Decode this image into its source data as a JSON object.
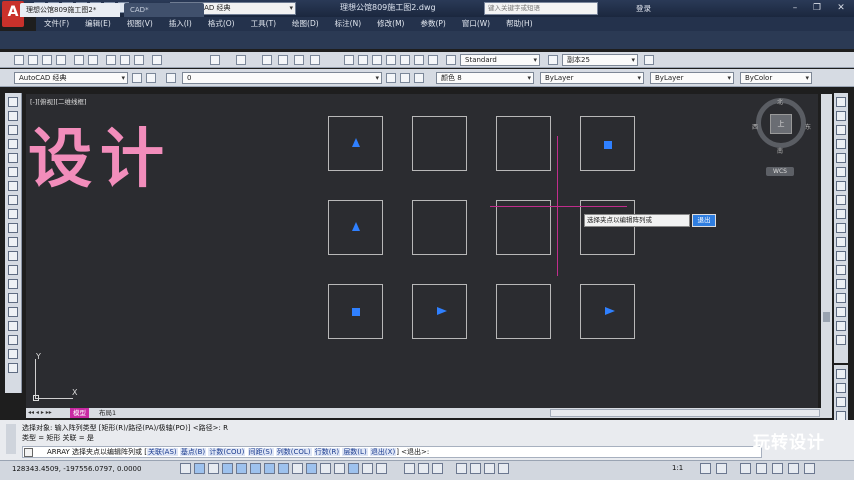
{
  "app": {
    "logo_letter": "A",
    "workspace": "AutoCAD 经典",
    "document_title": "理想公馆809施工图2.dwg",
    "search_placeholder": "键入关键字或短语",
    "login_label": "登录",
    "window_controls": [
      "–",
      "❐",
      "✕"
    ]
  },
  "menu": [
    "文件(F)",
    "编辑(E)",
    "视图(V)",
    "插入(I)",
    "格式(O)",
    "工具(T)",
    "绘图(D)",
    "标注(N)",
    "修改(M)",
    "参数(P)",
    "窗口(W)",
    "帮助(H)"
  ],
  "tabs": [
    {
      "label": "理想公馆809施工图2*"
    },
    {
      "label": "CAD*"
    }
  ],
  "toolbar2": {
    "text_style": "Standard",
    "dim_style": "副本25"
  },
  "toolbar3": {
    "workspace": "AutoCAD 经典",
    "layer": "0",
    "color": "颜色 8",
    "linetype": "ByLayer",
    "lineweight": "ByLayer",
    "plotstyle": "ByColor"
  },
  "canvas": {
    "view_label": "[-][俯视][二维线框]",
    "watermark_text": "设计",
    "tooltip_text": "选择夹点以编辑阵列或",
    "tooltip_input": "退出",
    "viewcube_face": "上",
    "compass": {
      "n": "北",
      "s": "南",
      "w": "西",
      "e": "东"
    },
    "wcs_label": "WCS",
    "ucs_x": "X",
    "ucs_y": "Y",
    "grip_icons": [
      "triangle-up",
      "square",
      "triangle-right"
    ]
  },
  "layout_tabs": [
    "模型",
    "布局1"
  ],
  "command": {
    "history_1": "选择对象:  输入阵列类型 [矩形(R)/路径(PA)/极轴(PO)] <路径>: R",
    "history_2": "类型 = 矩形  关联 = 是",
    "prompt_prefix": "ARRAY 选择夹点以编辑阵列或",
    "options": [
      "关联(AS)",
      "基点(B)",
      "计数(COU)",
      "间距(S)",
      "列数(COL)",
      "行数(R)",
      "层数(L)",
      "退出(X)"
    ],
    "prompt_suffix": "<退出>:"
  },
  "status": {
    "coords": "128343.4509,  -197556.0797,  0.0000",
    "anno_scale": "1:1"
  },
  "brand_watermark": "玩转设计",
  "colors": {
    "canvas_bg": "#2b2c30",
    "grip_blue": "#2f80ff",
    "watermark_pink": "#f28dbb",
    "crosshair": "#c02d8c"
  }
}
